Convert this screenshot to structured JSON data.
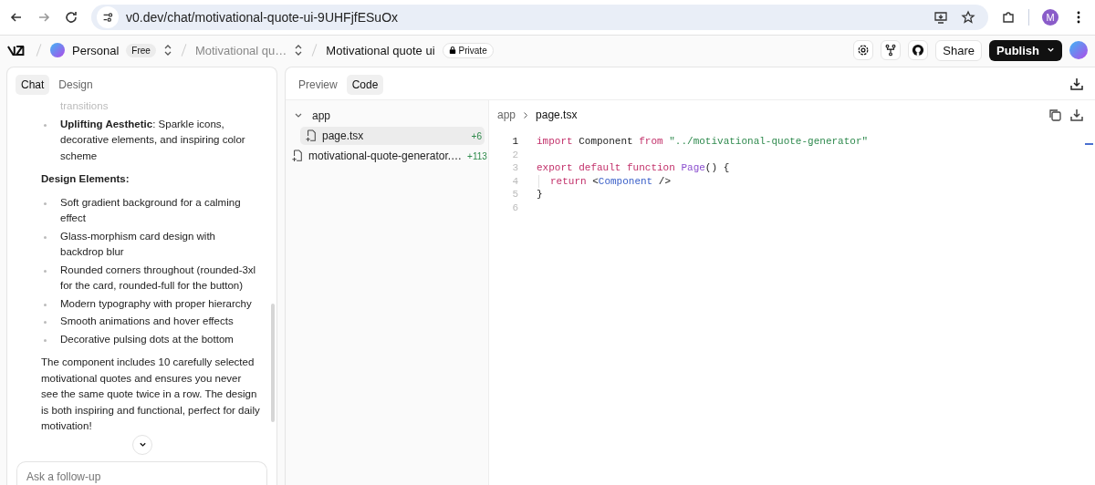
{
  "browser": {
    "url": "v0.dev/chat/motivational-quote-ui-9UHFjfESuOx",
    "profile": "M"
  },
  "header": {
    "team": "Personal",
    "plan": "Free",
    "project": "Motivational qu…",
    "chat_title": "Motivational quote ui",
    "visibility": "Private",
    "share": "Share",
    "publish": "Publish"
  },
  "chat": {
    "tabs": [
      {
        "label": "Chat",
        "selected": true
      },
      {
        "label": "Design",
        "selected": false
      }
    ],
    "blocks": [
      {
        "kind": "continuation",
        "text": "transitions"
      },
      {
        "kind": "bullet",
        "text": "**Uplifting Aesthetic**: Sparkle icons, decorative elements, and inspiring color scheme"
      },
      {
        "kind": "heading",
        "text": "Design Elements:"
      },
      {
        "kind": "bullet",
        "text": "Soft gradient background for a calming effect"
      },
      {
        "kind": "bullet",
        "text": "Glass-morphism card design with backdrop blur"
      },
      {
        "kind": "bullet",
        "text": "Rounded corners throughout (rounded-3xl for the card, rounded-full for the button)"
      },
      {
        "kind": "bullet",
        "text": "Modern typography with proper hierarchy"
      },
      {
        "kind": "bullet",
        "text": "Smooth animations and hover effects"
      },
      {
        "kind": "bullet",
        "text": "Decorative pulsing dots at the bottom"
      },
      {
        "kind": "para",
        "text": "The component includes 10 carefully selected motivational quotes and ensures you never see the same quote twice in a row. The design is both inspiring and functional, perfect for daily motivation!"
      }
    ],
    "input": {
      "placeholder": "Ask a follow-up"
    }
  },
  "workspace": {
    "tabs": [
      {
        "label": "Preview",
        "selected": false
      },
      {
        "label": "Code",
        "selected": true
      }
    ],
    "files": [
      {
        "name": "app",
        "kind": "folder",
        "expanded": true,
        "children": [
          {
            "name": "page.tsx",
            "kind": "file",
            "selected": true,
            "added": "+6"
          }
        ]
      },
      {
        "name": "motivational-quote-generator.…",
        "kind": "file",
        "selected": false,
        "added": "+113"
      }
    ],
    "breadcrumb": [
      "app",
      "page.tsx"
    ],
    "code": [
      {
        "number": "1",
        "current": true,
        "indented": false,
        "tokens": [
          {
            "t": "import",
            "kind": "keyword"
          },
          {
            "t": " Component ",
            "kind": "plain"
          },
          {
            "t": "from ",
            "kind": "keyword"
          },
          {
            "t": "\"../motivational-quote-generator\"",
            "kind": "string"
          }
        ]
      },
      {
        "number": "2",
        "current": false,
        "indented": false
      },
      {
        "number": "3",
        "current": false,
        "indented": false,
        "tokens": [
          {
            "t": "export default function ",
            "kind": "keyword"
          },
          {
            "t": "Page",
            "kind": "function"
          },
          {
            "t": "() {",
            "kind": "plain"
          }
        ]
      },
      {
        "number": "4",
        "current": false,
        "indented": true,
        "tokens": [
          {
            "t": "return",
            "kind": "keyword"
          },
          {
            "t": " <",
            "kind": "plain"
          },
          {
            "t": "Component",
            "kind": "tag"
          },
          {
            "t": " />",
            "kind": "plain"
          }
        ]
      },
      {
        "number": "5",
        "current": false,
        "indented": false,
        "tokens": [
          {
            "t": "}",
            "kind": "plain"
          }
        ]
      },
      {
        "number": "6",
        "current": false,
        "indented": false
      }
    ]
  }
}
